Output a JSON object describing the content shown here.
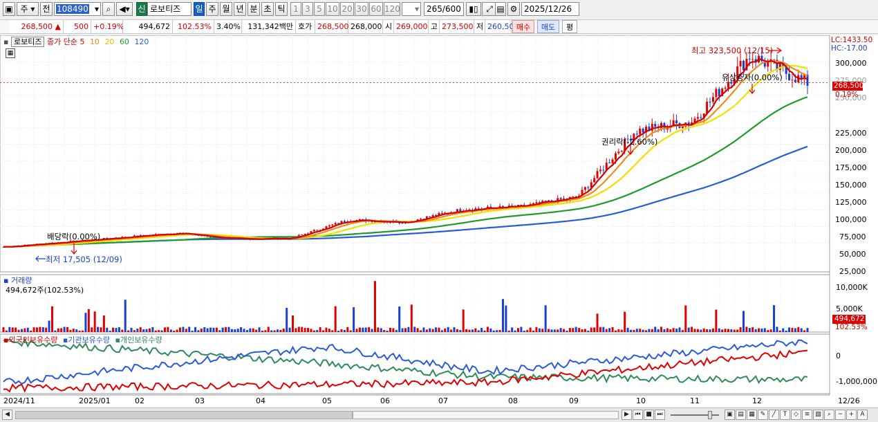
{
  "toolbar": {
    "type_label": "주",
    "prev_label": "전",
    "code_value": "108490",
    "stock_badge": "신",
    "stock_name": "로보티즈",
    "periods": [
      "일",
      "주",
      "월",
      "년",
      "분",
      "초",
      "틱"
    ],
    "selected_period": "일",
    "intervals": [
      "1",
      "3",
      "5",
      "10",
      "20",
      "30",
      "60",
      "120"
    ],
    "count_value": "265",
    "count_total": "/600",
    "date_value": "2025/12/26"
  },
  "quote": {
    "price": "268,500",
    "change": "500",
    "change_pct": "+0.19%",
    "volume": "494,672",
    "vol_ratio": "102.53%",
    "turnover_pct": "3.40%",
    "trade_value": "131,342백만",
    "bid_label": "호가",
    "bid_value": "268,500",
    "ask_value": "268,000",
    "open_label": "시",
    "open_value": "269,000",
    "high_label": "고",
    "high_value": "273,500",
    "low_label": "저",
    "low_value": "260,500",
    "buy_label": "매수",
    "sell_label": "매도",
    "eval_label": "평"
  },
  "main_panel": {
    "title": "로보티즈",
    "ma_label": "종가 단순",
    "ma_periods": [
      "5",
      "10",
      "20",
      "60",
      "120"
    ],
    "lc": "LC:1433.50",
    "hc": "HC:-17.00",
    "price_axis": [
      "300,000",
      "275,000",
      "250,000",
      "225,000",
      "200,000",
      "175,000",
      "150,000",
      "125,000",
      "100,000",
      "75,000",
      "50,000",
      "25,000"
    ],
    "current_price_tag": "268,500",
    "current_pct_tag": "0.19%",
    "annotations": {
      "high": "최고 323,500 (12/15)",
      "low": "최저 17,505 (12/09)",
      "dividend": "배당락(0.00%)",
      "rights": "권리락(-2.60%)",
      "offering": "유상증자(0.00%)"
    }
  },
  "volume_panel": {
    "title": "거래량",
    "subtitle": "494,672주(102.53%)",
    "axis": [
      "10,000K",
      "5,000K"
    ],
    "current_tag": "494,672",
    "current_pct_tag": "102.53%"
  },
  "holding_panel": {
    "legend_foreign": "외국인보유수량",
    "legend_institution": "기관보유수량",
    "legend_individual": "개인보유수량",
    "axis": [
      "0",
      "-1,000,000"
    ]
  },
  "xaxis": {
    "labels": [
      "2024/11",
      "2025/01",
      "02",
      "03",
      "04",
      "05",
      "06",
      "07",
      "08",
      "09",
      "10",
      "11",
      "12"
    ],
    "end_label": "12/26"
  },
  "colors": {
    "up": "#e00000",
    "down": "#1a3fd1",
    "ma5": "#d40000",
    "ma10": "#f08c1a",
    "ma20": "#f0e000",
    "ma60": "#1e9a2e",
    "ma120": "#2a5bd7",
    "foreign": "#e00000",
    "institution": "#2a5bd7",
    "individual": "#2e8b57"
  },
  "chart_data": {
    "type": "candlestick",
    "title": "로보티즈",
    "x_ticks": [
      "2024/11",
      "2025/01",
      "02",
      "03",
      "04",
      "05",
      "06",
      "07",
      "08",
      "09",
      "10",
      "11",
      "12",
      "12/26"
    ],
    "ylim": [
      0,
      330000
    ],
    "close_series": [
      [
        "2024/11",
        19000
      ],
      [
        "2024/12",
        26000
      ],
      [
        "2025/01",
        33000
      ],
      [
        "2025/02",
        40000
      ],
      [
        "2025/03",
        31000
      ],
      [
        "2025/04",
        32000
      ],
      [
        "2025/05",
        60000
      ],
      [
        "2025/06",
        57000
      ],
      [
        "2025/07",
        76000
      ],
      [
        "2025/08",
        80000
      ],
      [
        "2025/09",
        95000
      ],
      [
        "2025/10",
        195000
      ],
      [
        "2025/11",
        210000
      ],
      [
        "2025/12",
        310000
      ],
      [
        "2025/12/26",
        268500
      ]
    ],
    "moving_averages": {
      "ma60_end": 225000,
      "ma120_end": 155000
    },
    "volume_max": 12000000,
    "holdings": {
      "foreign": [
        [
          0,
          -1200000
        ],
        [
          0.6,
          -1000000
        ],
        [
          1.0,
          100000
        ],
        [
          1.1,
          -200000
        ]
      ],
      "institution": [
        [
          0,
          -1000000
        ],
        [
          0.4,
          300000
        ],
        [
          0.6,
          -600000
        ],
        [
          1.0,
          500000
        ]
      ],
      "individual": [
        [
          0,
          500000
        ],
        [
          0.4,
          -300000
        ],
        [
          0.6,
          -800000
        ],
        [
          1.0,
          -900000
        ]
      ]
    }
  }
}
